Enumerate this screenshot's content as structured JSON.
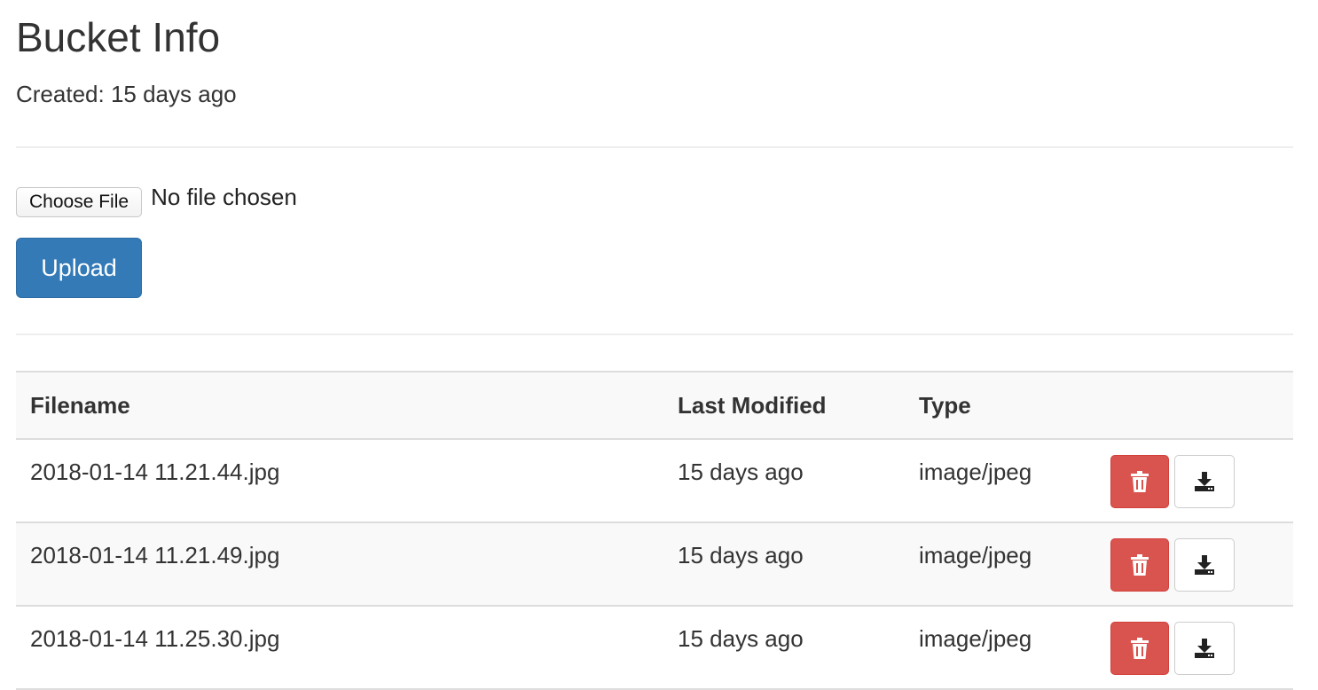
{
  "page": {
    "title": "Bucket Info",
    "created": "Created: 15 days ago"
  },
  "upload": {
    "choose_label": "Choose File",
    "file_status": "No file chosen",
    "upload_label": "Upload"
  },
  "table": {
    "headers": [
      "Filename",
      "Last Modified",
      "Type"
    ],
    "rows": [
      {
        "filename": "2018-01-14 11.21.44.jpg",
        "modified": "15 days ago",
        "type": "image/jpeg"
      },
      {
        "filename": "2018-01-14 11.21.49.jpg",
        "modified": "15 days ago",
        "type": "image/jpeg"
      },
      {
        "filename": "2018-01-14 11.25.30.jpg",
        "modified": "15 days ago",
        "type": "image/jpeg"
      }
    ]
  },
  "icons": {
    "delete": "trash-icon",
    "download": "download-icon"
  },
  "colors": {
    "primary": "#337ab7",
    "danger": "#d9534f"
  }
}
